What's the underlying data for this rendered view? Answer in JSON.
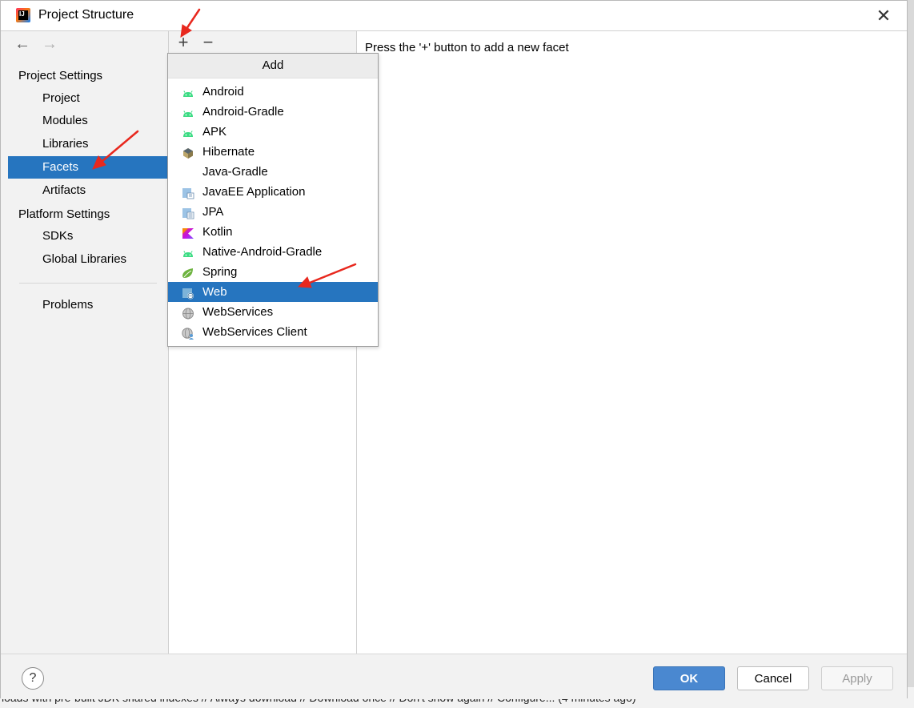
{
  "window": {
    "title": "Project Structure",
    "close_glyph": "✕",
    "app_icon": "intellij-idea-icon",
    "app_icon_text": "IJ"
  },
  "nav": {
    "back": "←",
    "forward": "→"
  },
  "sidebar": {
    "project_settings": "Project Settings",
    "project_items": [
      "Project",
      "Modules",
      "Libraries",
      "Facets",
      "Artifacts"
    ],
    "platform_settings": "Platform Settings",
    "platform_items": [
      "SDKs",
      "Global Libraries"
    ],
    "problems": "Problems",
    "selected": "Facets",
    "selected_color": "#2675bf"
  },
  "toolbar": {
    "add": "+",
    "remove": "−"
  },
  "right_panel": {
    "hint": "Press the '+' button to add a new facet"
  },
  "add_popup": {
    "header": "Add",
    "selected": "Web",
    "items": [
      {
        "label": "Android",
        "icon": "android-icon"
      },
      {
        "label": "Android-Gradle",
        "icon": "android-icon"
      },
      {
        "label": "APK",
        "icon": "android-icon"
      },
      {
        "label": "Hibernate",
        "icon": "hibernate-icon"
      },
      {
        "label": "Java-Gradle",
        "icon": "none"
      },
      {
        "label": "JavaEE Application",
        "icon": "javaee-icon"
      },
      {
        "label": "JPA",
        "icon": "jpa-icon"
      },
      {
        "label": "Kotlin",
        "icon": "kotlin-icon"
      },
      {
        "label": "Native-Android-Gradle",
        "icon": "android-icon"
      },
      {
        "label": "Spring",
        "icon": "spring-icon"
      },
      {
        "label": "Web",
        "icon": "web-icon"
      },
      {
        "label": "WebServices",
        "icon": "webservices-icon"
      },
      {
        "label": "WebServices Client",
        "icon": "webservices-client-icon"
      }
    ]
  },
  "footer": {
    "help": "?",
    "ok": "OK",
    "cancel": "Cancel",
    "apply": "Apply"
  },
  "status_bar": {
    "text": "loads with pre-built JDK shared indexes // Always download // Download once // Don't show again // Configure... (4 minutes ago)"
  },
  "colors": {
    "accent": "#2675bf",
    "annotation_arrow": "#e8281e",
    "android_green": "#3ddc84",
    "spring_green": "#6db33f"
  }
}
